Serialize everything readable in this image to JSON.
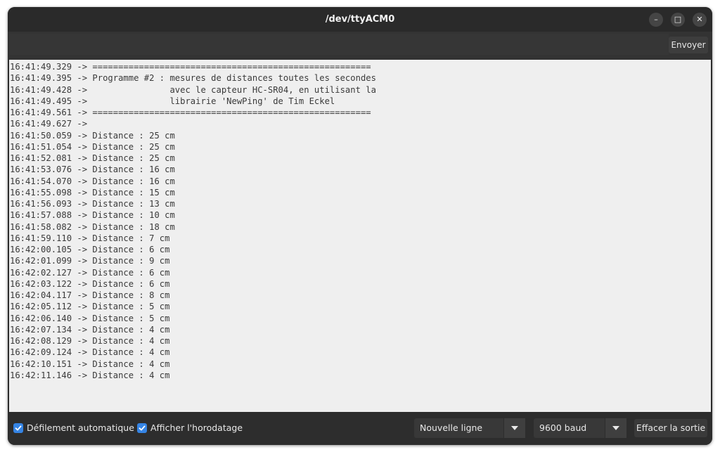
{
  "window": {
    "title": "/dev/ttyACM0"
  },
  "controls": {
    "minimize": "–",
    "maximize": "□",
    "close": "✕"
  },
  "send": {
    "button_label": "Envoyer",
    "input_value": ""
  },
  "output": {
    "lines": [
      "16:41:49.329 -> ======================================================",
      "16:41:49.395 -> Programme #2 : mesures de distances toutes les secondes",
      "16:41:49.428 ->                avec le capteur HC-SR04, en utilisant la",
      "16:41:49.495 ->                librairie 'NewPing' de Tim Eckel",
      "16:41:49.561 -> ======================================================",
      "16:41:49.627 -> ",
      "16:41:50.059 -> Distance : 25 cm",
      "16:41:51.054 -> Distance : 25 cm",
      "16:41:52.081 -> Distance : 25 cm",
      "16:41:53.076 -> Distance : 16 cm",
      "16:41:54.070 -> Distance : 16 cm",
      "16:41:55.098 -> Distance : 15 cm",
      "16:41:56.093 -> Distance : 13 cm",
      "16:41:57.088 -> Distance : 10 cm",
      "16:41:58.082 -> Distance : 18 cm",
      "16:41:59.110 -> Distance : 7 cm",
      "16:42:00.105 -> Distance : 6 cm",
      "16:42:01.099 -> Distance : 9 cm",
      "16:42:02.127 -> Distance : 6 cm",
      "16:42:03.122 -> Distance : 6 cm",
      "16:42:04.117 -> Distance : 8 cm",
      "16:42:05.112 -> Distance : 5 cm",
      "16:42:06.140 -> Distance : 5 cm",
      "16:42:07.134 -> Distance : 4 cm",
      "16:42:08.129 -> Distance : 4 cm",
      "16:42:09.124 -> Distance : 4 cm",
      "16:42:10.151 -> Distance : 4 cm",
      "16:42:11.146 -> Distance : 4 cm"
    ]
  },
  "footer": {
    "autoscroll_label": "Défilement automatique",
    "autoscroll_checked": true,
    "timestamp_label": "Afficher l'horodatage",
    "timestamp_checked": true,
    "line_ending_value": "Nouvelle ligne",
    "baud_value": "9600 baud",
    "clear_label": "Effacer la sortie"
  },
  "colors": {
    "accent": "#3584e4",
    "titlebar": "#2a2a2a",
    "output_bg": "#efefef"
  }
}
